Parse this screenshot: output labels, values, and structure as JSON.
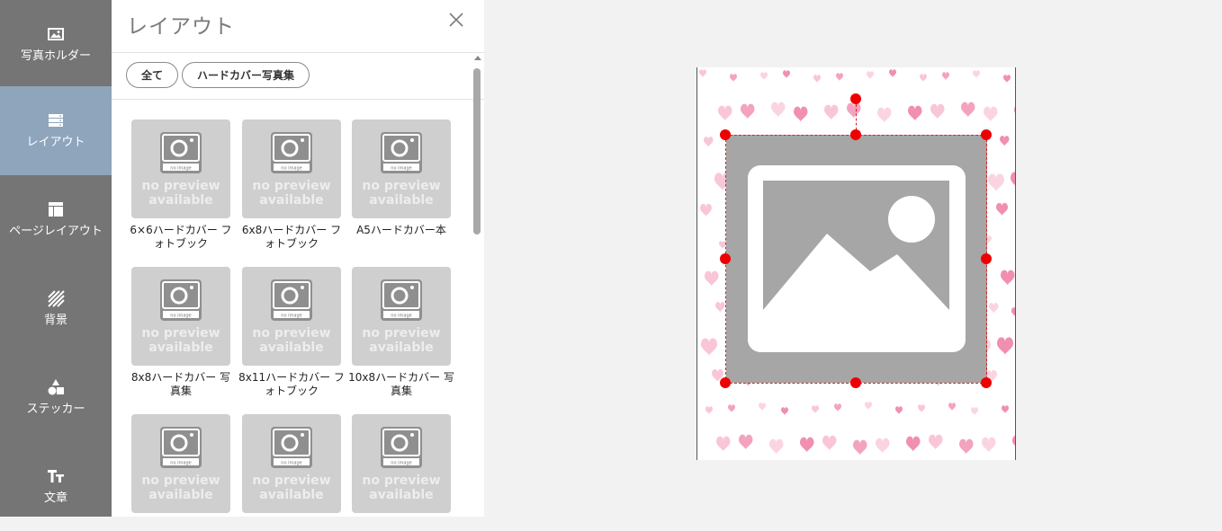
{
  "sidebar": {
    "items": [
      {
        "label": "写真ホルダー",
        "icon": "photo-icon",
        "active": false
      },
      {
        "label": "レイアウト",
        "icon": "layout-icon",
        "active": true
      },
      {
        "label": "ページレイアウト",
        "icon": "page-layout-icon",
        "active": false
      },
      {
        "label": "背景",
        "icon": "background-icon",
        "active": false
      },
      {
        "label": "ステッカー",
        "icon": "sticker-icon",
        "active": false
      },
      {
        "label": "文章",
        "icon": "text-icon",
        "active": false
      }
    ]
  },
  "panel": {
    "title": "レイアウト",
    "filters": [
      "全て",
      "ハードカバー写真集"
    ],
    "no_preview": "no preview available",
    "camera_caption": "no image",
    "layouts": [
      {
        "label": "6×6ハードカバー フォトブック"
      },
      {
        "label": "6x8ハードカバー フォトブック"
      },
      {
        "label": "A5ハードカバー本"
      },
      {
        "label": "8x8ハードカバー 写真集"
      },
      {
        "label": "8x11ハードカバー フォトブック"
      },
      {
        "label": "10x8ハードカバー 写真集"
      },
      {
        "label": ""
      },
      {
        "label": ""
      },
      {
        "label": ""
      }
    ]
  },
  "colors": {
    "rail": "#757575",
    "rail_active": "#8fa5bc",
    "selection": "#ee0000",
    "placeholder": "#a6a6a6"
  }
}
